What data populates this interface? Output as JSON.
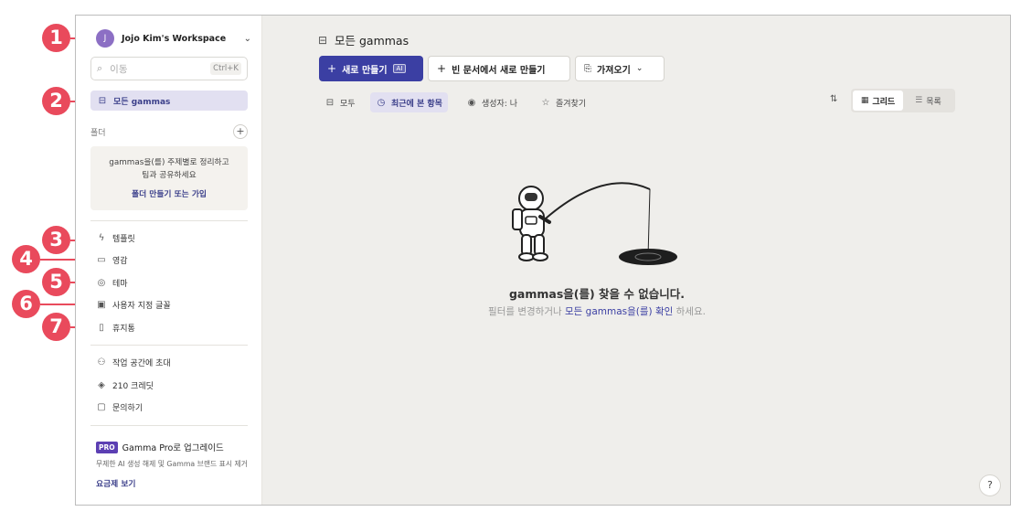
{
  "sidebar": {
    "workspace": {
      "avatar": "J",
      "name": "Jojo Kim's Workspace",
      "chevron_icon": "chevron-down-icon"
    },
    "search": {
      "placeholder": "이동",
      "shortcut": "Ctrl+K"
    },
    "all_gammas": "모든 gammas",
    "folders": {
      "label": "폴더",
      "empty_desc_1": "gammas을(를) 주제별로 정리하고",
      "empty_desc_2": "팀과 공유하세요",
      "create_link": "폴더 만들기 또는 가입"
    },
    "menu": [
      {
        "label": "템플릿",
        "icon": "template-icon"
      },
      {
        "label": "영감",
        "icon": "book-icon"
      },
      {
        "label": "테마",
        "icon": "palette-icon"
      },
      {
        "label": "사용자 지정 글꼴",
        "icon": "font-icon"
      },
      {
        "label": "휴지통",
        "icon": "trash-icon"
      }
    ],
    "extra": [
      {
        "label": "작업 공간에 초대",
        "icon": "invite-icon"
      },
      {
        "label": "210 크레딧",
        "icon": "credits-icon"
      },
      {
        "label": "문의하기",
        "icon": "chat-icon"
      }
    ],
    "promo": {
      "badge": "PRO",
      "title": "Gamma Pro로 업그레이드",
      "desc": "무제한 AI 생성 해제 및 Gamma 브랜드 표시 제거",
      "link": "요금제 보기"
    }
  },
  "callouts": [
    "1",
    "2",
    "3",
    "4",
    "5",
    "6",
    "7"
  ],
  "main": {
    "title": "모든 gammas",
    "buttons": {
      "new": "새로 만들기",
      "ai_badge": "AI",
      "new_blank": "빈 문서에서 새로 만들기",
      "import": "가져오기"
    },
    "filters": [
      {
        "label": "모두",
        "icon": "stack-icon"
      },
      {
        "label": "최근에 본 항목",
        "icon": "clock-icon"
      },
      {
        "label": "생성자: 나",
        "icon": "user-icon"
      },
      {
        "label": "즐겨찾기",
        "icon": "star-icon"
      }
    ],
    "view": {
      "grid": "그리드",
      "list": "목록"
    },
    "empty": {
      "title": "gammas을(를) 찾을 수 없습니다.",
      "sub_before": "필터를 변경하거나",
      "sub_link": "모든 gammas을(를) 확인",
      "sub_after": "하세요."
    },
    "help": "?"
  },
  "colors": {
    "accent": "#3b3fa3",
    "callout": "#e94a5c",
    "active_bg": "#e2e0f1",
    "main_bg": "#efeeeb"
  }
}
